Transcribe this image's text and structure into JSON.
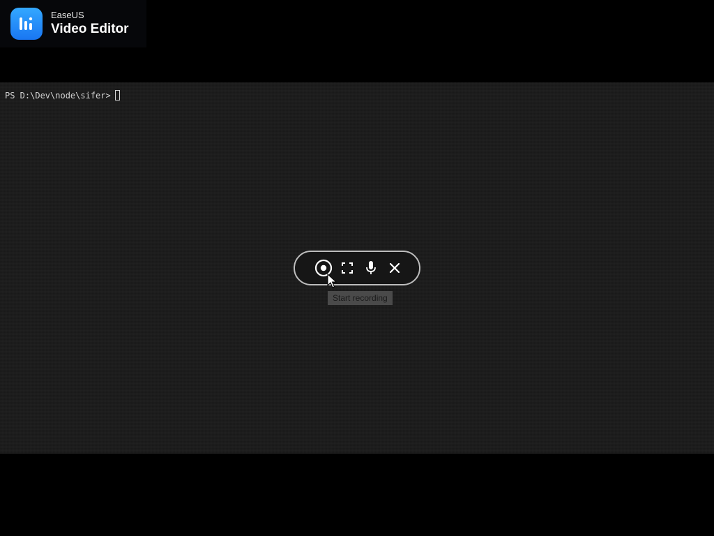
{
  "watermark": {
    "brand": "EaseUS",
    "product": "Video Editor",
    "logo_icon": "audio-bars-logo-icon",
    "logo_color": "#1f8af5"
  },
  "terminal": {
    "prompt": "PS D:\\Dev\\node\\sifer>",
    "background_color": "#1c1c1c",
    "text_color": "#d4d4d4"
  },
  "recorder": {
    "buttons": [
      {
        "name": "record",
        "icon": "record-icon"
      },
      {
        "name": "fullscreen",
        "icon": "fullscreen-icon"
      },
      {
        "name": "microphone",
        "icon": "microphone-icon"
      },
      {
        "name": "close",
        "icon": "close-icon"
      }
    ],
    "tooltip": "Start recording",
    "border_color": "#bdbdbd"
  }
}
